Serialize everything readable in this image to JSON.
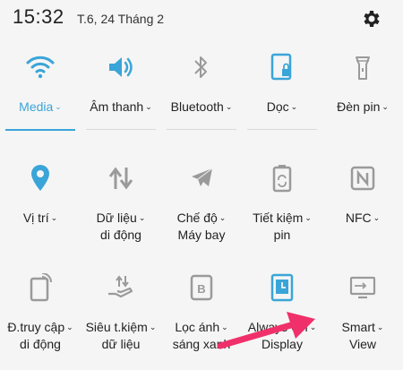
{
  "status": {
    "time": "15:32",
    "date": "T.6, 24 Tháng 2"
  },
  "icons": {
    "settings": "gear-icon"
  },
  "colors": {
    "accent": "#3aa5d8",
    "icon_gray": "#9a9a9a",
    "arrow": "#f0306a"
  },
  "tiles": [
    {
      "line1": "Media",
      "line2": "",
      "icon": "wifi-icon",
      "active": true
    },
    {
      "line1": "Âm thanh",
      "line2": "",
      "icon": "volume-icon",
      "active": true
    },
    {
      "line1": "Bluetooth",
      "line2": "",
      "icon": "bluetooth-icon",
      "active": false
    },
    {
      "line1": "Dọc",
      "line2": "",
      "icon": "rotation-lock-icon",
      "active": true
    },
    {
      "line1": "Đèn pin",
      "line2": "",
      "icon": "flashlight-icon",
      "active": false
    },
    {
      "line1": "Vị trí",
      "line2": "",
      "icon": "location-icon",
      "active": true
    },
    {
      "line1": "Dữ liệu",
      "line2": "di động",
      "icon": "mobile-data-icon",
      "active": false
    },
    {
      "line1": "Chế độ",
      "line2": "Máy bay",
      "icon": "airplane-icon",
      "active": false
    },
    {
      "line1": "Tiết kiệm",
      "line2": "pin",
      "icon": "battery-saver-icon",
      "active": false
    },
    {
      "line1": "NFC",
      "line2": "",
      "icon": "nfc-icon",
      "active": false
    },
    {
      "line1": "Đ.truy cập",
      "line2": "di động",
      "icon": "mobile-hotspot-icon",
      "active": false
    },
    {
      "line1": "Siêu t.kiệm",
      "line2": "dữ liệu",
      "icon": "data-saver-icon",
      "active": false
    },
    {
      "line1": "Lọc ánh",
      "line2": "sáng xanh",
      "icon": "blue-light-filter-icon",
      "active": false
    },
    {
      "line1": "Always On",
      "line2": "Display",
      "icon": "always-on-display-icon",
      "active": true
    },
    {
      "line1": "Smart",
      "line2": "View",
      "icon": "smart-view-icon",
      "active": false
    }
  ]
}
